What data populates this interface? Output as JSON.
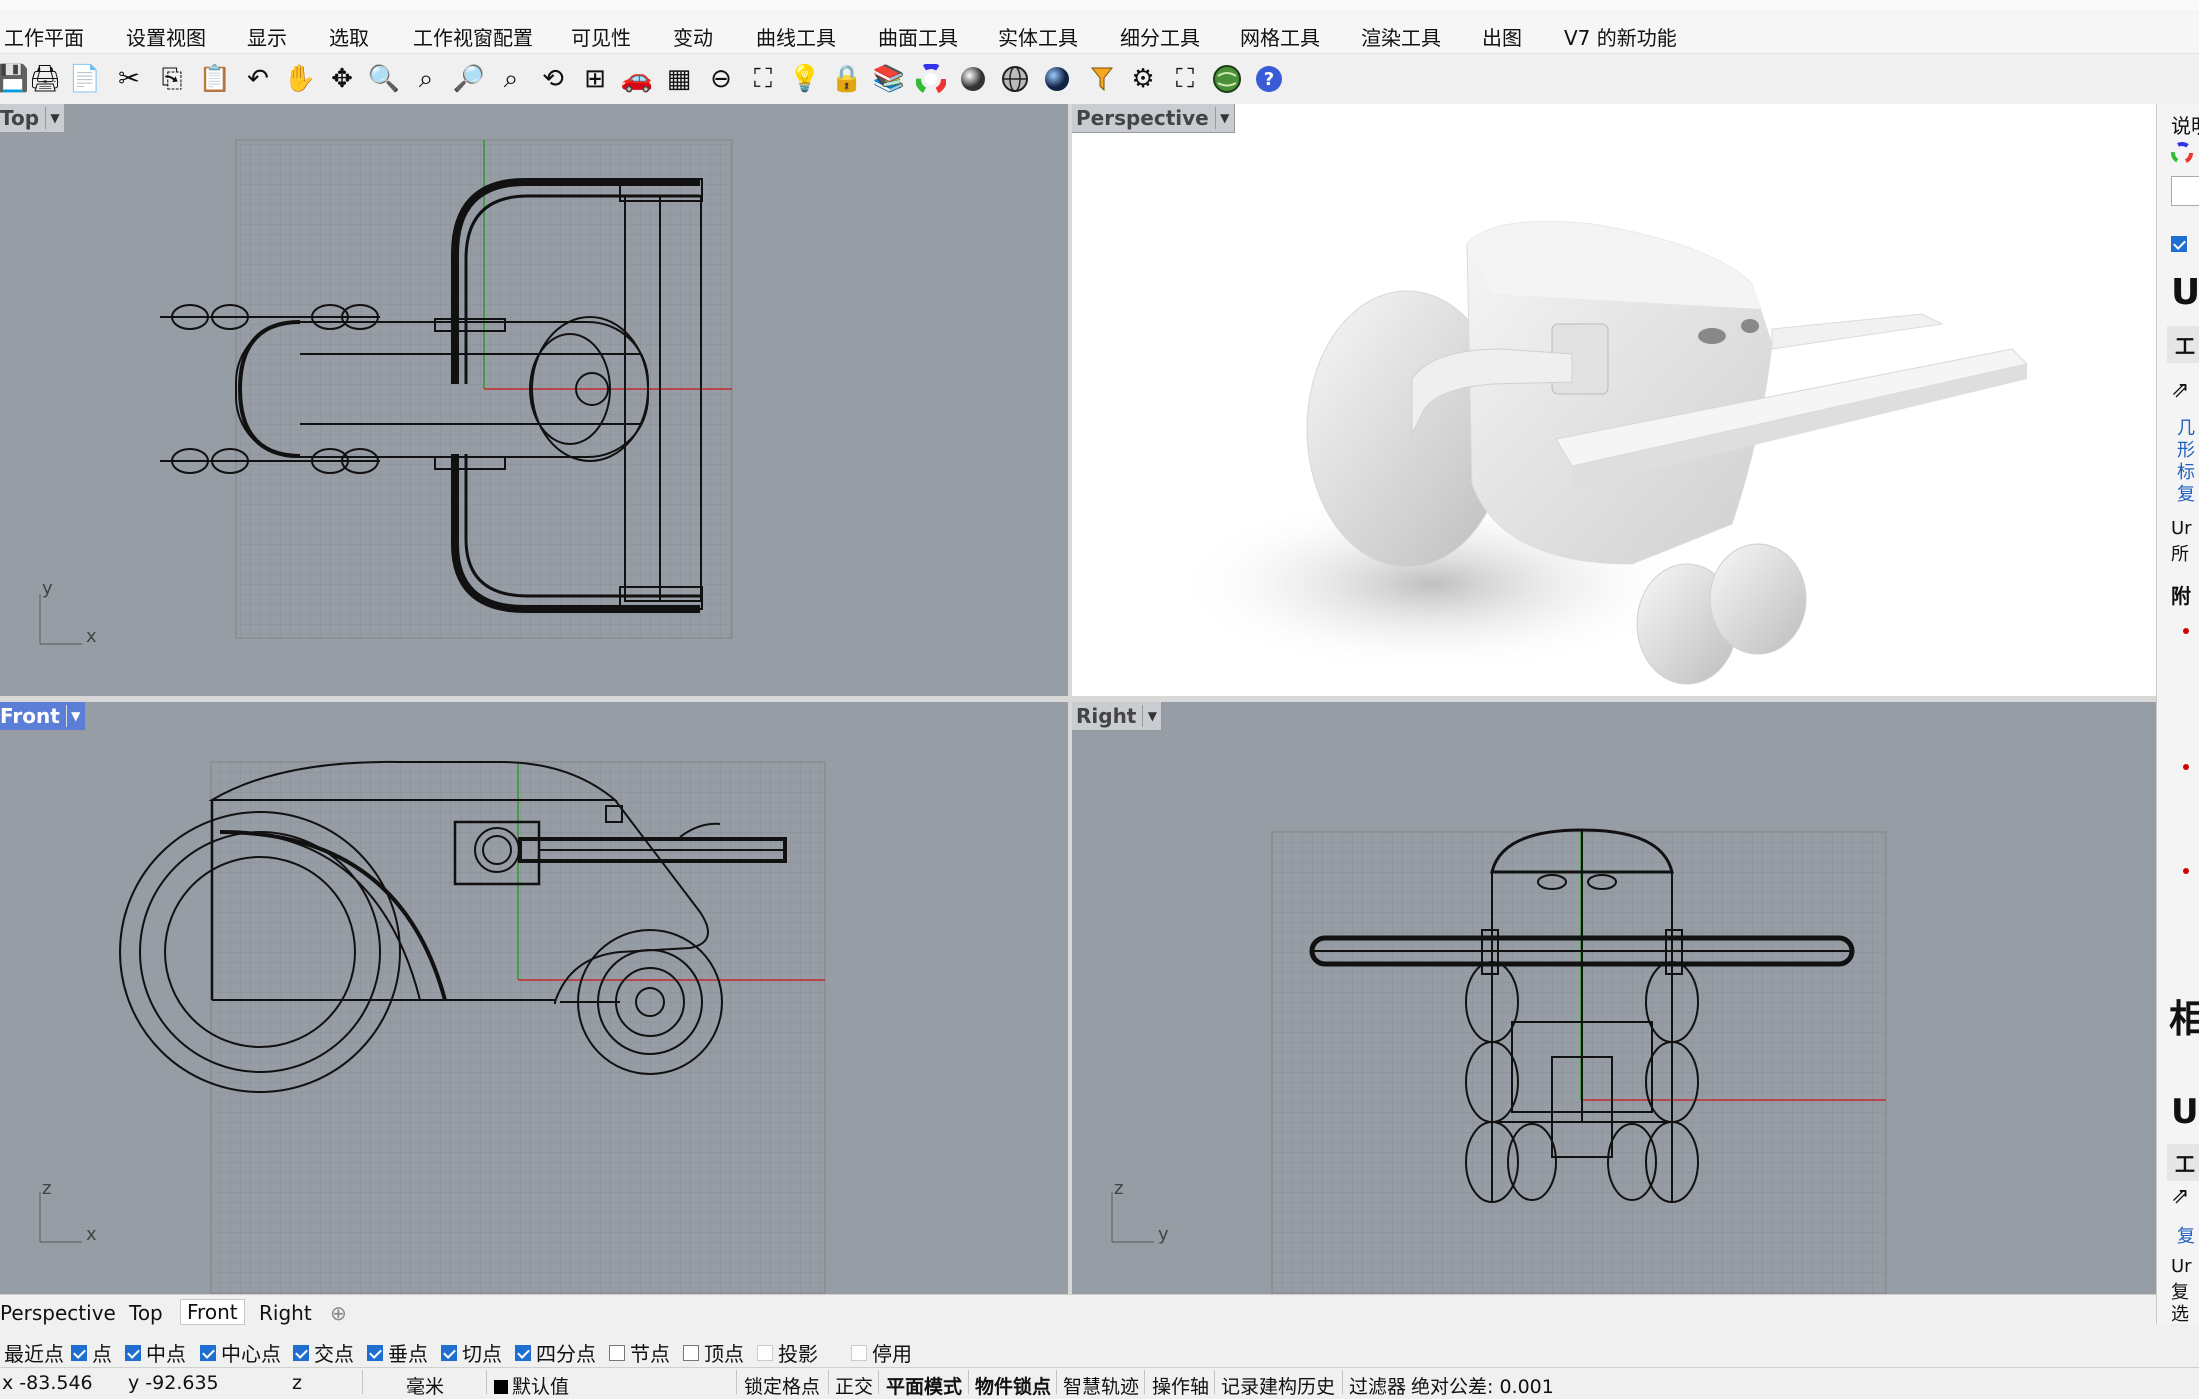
{
  "menubar": {
    "items": [
      "工作平面",
      "设置视图",
      "显示",
      "选取",
      "工作视窗配置",
      "可见性",
      "变动",
      "曲线工具",
      "曲面工具",
      "实体工具",
      "细分工具",
      "网格工具",
      "渲染工具",
      "出图",
      "V7 的新功能"
    ]
  },
  "toolbar": {
    "icons": [
      "save-icon",
      "print-icon",
      "page-icon",
      "cut-icon",
      "copy-icon",
      "paste-icon",
      "undo-icon",
      "pan-hand-icon",
      "rotate-view-icon",
      "zoom-in-icon",
      "zoom-window-icon",
      "zoom-extents-icon",
      "zoom-selected-icon",
      "undo-view-icon",
      "four-viewports-icon",
      "car-icon",
      "grid-plane-icon",
      "point-osnap-icon",
      "select-icon",
      "light-bulb-icon",
      "lock-icon",
      "layer-icon",
      "color-wheel-icon",
      "sphere-shaded-icon",
      "sphere-wire-icon",
      "sphere-blue-icon",
      "filter-icon",
      "gear-icon",
      "snap-grid-icon",
      "globe-icon",
      "help-icon"
    ]
  },
  "viewports": {
    "top": {
      "label": "Top"
    },
    "perspective": {
      "label": "Perspective"
    },
    "front": {
      "label": "Front"
    },
    "right": {
      "label": "Right"
    }
  },
  "axes": {
    "top": {
      "a": "y",
      "b": "x"
    },
    "front": {
      "a": "z",
      "b": "x"
    },
    "right": {
      "a": "z",
      "b": "y"
    }
  },
  "right_panel": {
    "header": "说明",
    "big1": "U",
    "item1": "工",
    "links1": [
      "几",
      "形",
      "标",
      "复"
    ],
    "text1": [
      "Ur",
      "所"
    ],
    "heading1": "附",
    "big2": "相",
    "big3": "U",
    "item2": "工",
    "link2": "复",
    "text2": [
      "Ur",
      "复",
      "选"
    ]
  },
  "viewport_tabs": [
    "Perspective",
    "Top",
    "Front",
    "Right"
  ],
  "active_viewport_tab": "Front",
  "osnap": [
    {
      "label": "最近点",
      "checked": null
    },
    {
      "label": "点",
      "checked": true
    },
    {
      "label": "中点",
      "checked": true
    },
    {
      "label": "中心点",
      "checked": true
    },
    {
      "label": "交点",
      "checked": true
    },
    {
      "label": "垂点",
      "checked": true
    },
    {
      "label": "切点",
      "checked": true
    },
    {
      "label": "四分点",
      "checked": true
    },
    {
      "label": "节点",
      "checked": false
    },
    {
      "label": "顶点",
      "checked": false
    },
    {
      "label": "投影",
      "checked": false
    },
    {
      "label": "停用",
      "checked": false
    }
  ],
  "status": {
    "x": "x -83.546",
    "y": "y -92.635",
    "z": "z",
    "units": "毫米",
    "layer": "默认值",
    "lock_grid": "锁定格点",
    "ortho": "正交",
    "planar": "平面模式",
    "osnap": "物件锁点",
    "smarttrack": "智慧轨迹",
    "gumball": "操作轴",
    "history": "记录建构历史",
    "filter": "过滤器",
    "tolerance": "绝对公差: 0.001"
  }
}
